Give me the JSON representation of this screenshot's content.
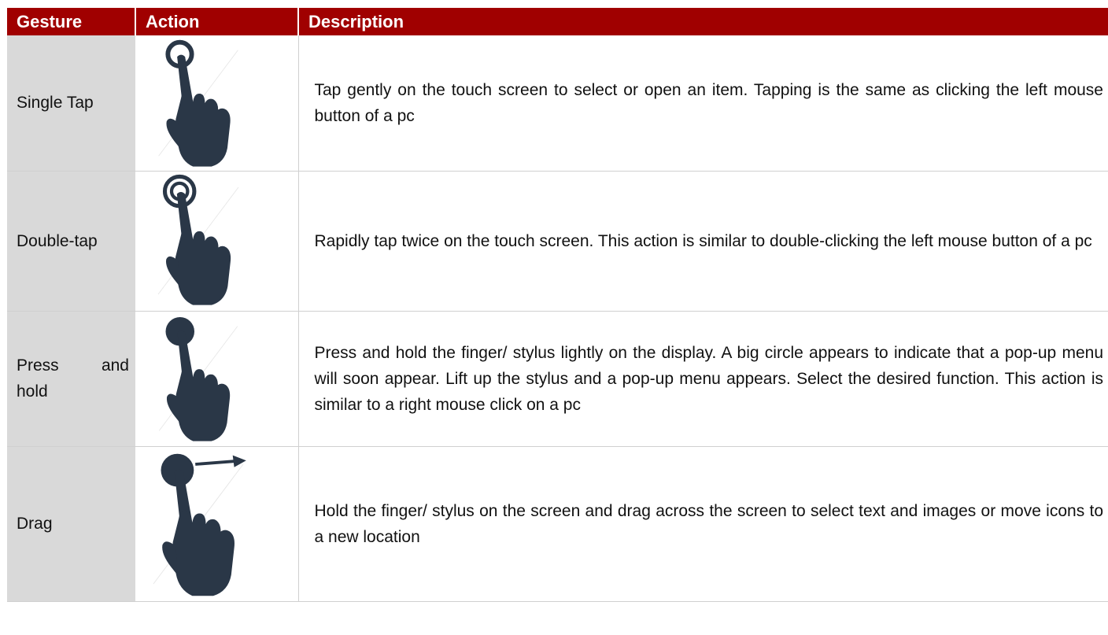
{
  "header": {
    "col_gesture": "Gesture",
    "col_action": "Action",
    "col_description": "Description"
  },
  "rows": [
    {
      "gesture": "Single Tap",
      "icon": "single-tap-icon",
      "description": "Tap gently on the touch screen to select or open an item. Tapping is the same as clicking the left mouse button of a pc"
    },
    {
      "gesture": "Double-tap",
      "icon": "double-tap-icon",
      "description": "Rapidly tap twice on the touch screen. This action is similar to double-clicking the left mouse button of a pc"
    },
    {
      "gesture": "Press and hold",
      "icon": "press-and-hold-icon",
      "description": "Press and hold the finger/ stylus lightly on the display. A big circle appears to indicate that a pop-up menu will soon appear. Lift up the stylus and a pop-up menu appears. Select the desired function. This action is similar to a right mouse click on a pc"
    },
    {
      "gesture": "Drag",
      "icon": "drag-icon",
      "description": "Hold the finger/ stylus on the screen and drag across the screen to select text and images or move icons to a new location"
    }
  ],
  "colors": {
    "header_bg": "#a00000",
    "gesture_col_bg": "#d9d9d9",
    "icon_color": "#2a3747"
  }
}
